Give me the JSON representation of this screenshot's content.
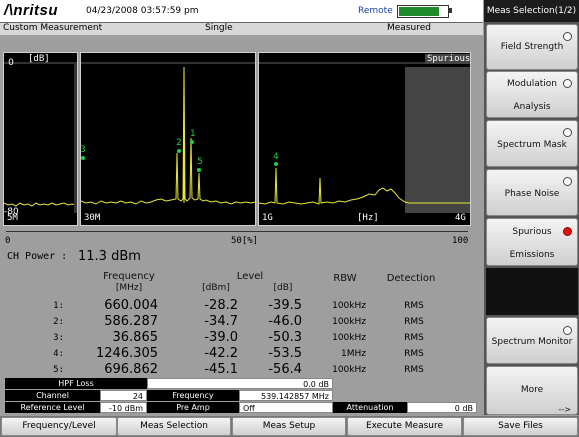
{
  "header": {
    "logo": "/\\nritsu",
    "datetime": "04/23/2008 03:57:59 pm",
    "remote": "Remote",
    "battery_level": 0.8
  },
  "status": {
    "mode": "Custom Measurement",
    "sweep": "Single",
    "state": "Measured"
  },
  "plot": {
    "ylabel": "[dB]",
    "ytop": "0",
    "ybottom": "-80",
    "panel1_bottom": "5M",
    "panel2_bottom": "30M",
    "panel3_bottom_left": "1G",
    "panel3_bottom_mid": "[Hz]",
    "panel3_bottom_right": "4G",
    "panel3_title": "Spurious",
    "markers": [
      "1",
      "2",
      "3",
      "4",
      "5"
    ],
    "colors": {
      "trace": "#e8e830",
      "marker": "#22cc44",
      "background": "#000000"
    }
  },
  "scale": {
    "left": "0",
    "mid": "50[%]",
    "right": "100"
  },
  "channel_power": {
    "label": "CH Power :",
    "value": "11.3 dBm"
  },
  "table": {
    "headers": {
      "frequency": "Frequency",
      "frequency_unit": "[MHz]",
      "level": "Level",
      "level_dbm": "[dBm]",
      "level_db": "[dB]",
      "rbw": "RBW",
      "detection": "Detection"
    },
    "rows": [
      {
        "idx": "1:",
        "freq": "660.004",
        "dbm": "-28.2",
        "db": "-39.5",
        "rbw": "100kHz",
        "det": "RMS"
      },
      {
        "idx": "2:",
        "freq": "586.287",
        "dbm": "-34.7",
        "db": "-46.0",
        "rbw": "100kHz",
        "det": "RMS"
      },
      {
        "idx": "3:",
        "freq": "36.865",
        "dbm": "-39.0",
        "db": "-50.3",
        "rbw": "100kHz",
        "det": "RMS"
      },
      {
        "idx": "4:",
        "freq": "1246.305",
        "dbm": "-42.2",
        "db": "-53.5",
        "rbw": "1MHz",
        "det": "RMS"
      },
      {
        "idx": "5:",
        "freq": "696.862",
        "dbm": "-45.1",
        "db": "-56.4",
        "rbw": "100kHz",
        "det": "RMS"
      }
    ]
  },
  "info": {
    "hpf_loss_label": "HPF Loss",
    "hpf_loss_value": "0.0 dB",
    "channel_label": "Channel",
    "channel_value": "24",
    "frequency_label": "Frequency",
    "frequency_value": "539.142857 MHz",
    "ref_level_label": "Reference Level",
    "ref_level_value": "-10 dBm",
    "preamp_label": "Pre Amp",
    "preamp_value": "Off",
    "attenuation_label": "Attenuation",
    "attenuation_value": "0 dB"
  },
  "side_menu": {
    "title": "Meas Selection(1/2)",
    "field_strength": "Field Strength",
    "modulation_1": "Modulation",
    "modulation_2": "Analysis",
    "spectrum_mask": "Spectrum Mask",
    "phase_noise": "Phase Noise",
    "spurious_1": "Spurious",
    "spurious_2": "Emissions",
    "spectrum_monitor": "Spectrum Monitor",
    "more": "More",
    "more_arrow": "-->"
  },
  "bottom_menu": {
    "freq_level": "Frequency/Level",
    "meas_selection": "Meas Selection",
    "meas_setup": "Meas Setup",
    "execute_measure": "Execute Measure",
    "save_files": "Save Files"
  }
}
